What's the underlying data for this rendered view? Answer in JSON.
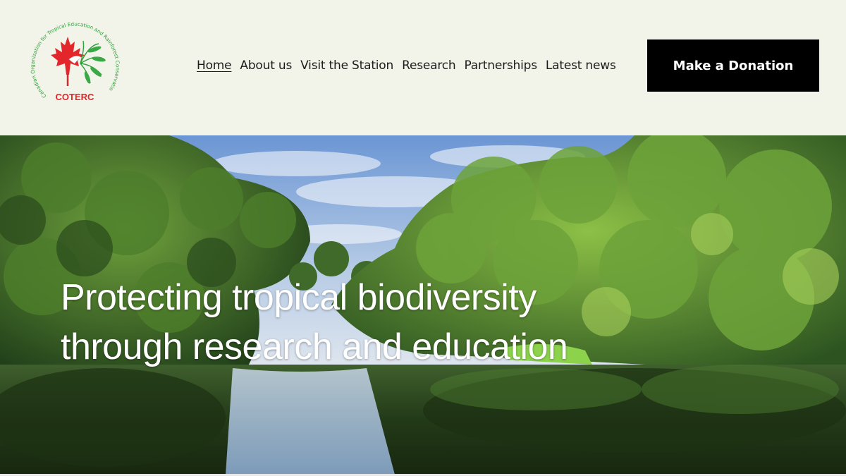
{
  "logo": {
    "arc_text": "Canadian Organization for Tropical Education and Rainforest Conservation",
    "acronym": "COTERC",
    "icon": "maple-leaf-palm-bird-logo"
  },
  "nav": {
    "items": [
      {
        "label": "Home",
        "active": true
      },
      {
        "label": "About us"
      },
      {
        "label": "Visit the Station"
      },
      {
        "label": "Research"
      },
      {
        "label": "Partnerships"
      },
      {
        "label": "Latest news"
      }
    ]
  },
  "donate_label": "Make a Donation",
  "hero": {
    "title_line1": "Protecting tropical biodiversity",
    "title_line2": "through research and education"
  },
  "colors": {
    "header_bg": "#f2f4e9",
    "button_bg": "#000000",
    "logo_red": "#e3262b",
    "logo_green": "#2f9e3a"
  }
}
